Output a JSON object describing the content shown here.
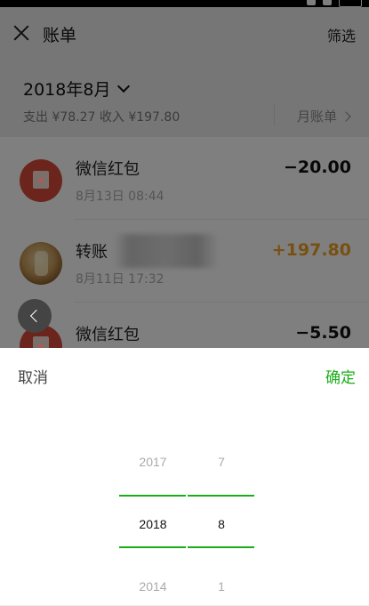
{
  "navbar": {
    "title": "账单",
    "filter_label": "筛选"
  },
  "month_header": {
    "selected_month": "2018年8月",
    "summary": "支出 ¥78.27 收入 ¥197.80",
    "month_bill_label": "月账单"
  },
  "transactions": [
    {
      "title": "微信红包",
      "time": "8月13日 08:44",
      "amount": "−20.00",
      "icon": "redpacket-icon"
    },
    {
      "title": "转账",
      "time": "8月11日 17:32",
      "amount": "+197.80",
      "icon": "contact-avatar"
    },
    {
      "title": "微信红包",
      "time": "",
      "amount": "−5.50",
      "icon": "redpacket-icon"
    }
  ],
  "picker": {
    "cancel_label": "取消",
    "confirm_label": "确定",
    "year": {
      "prev": "2017",
      "current": "2018",
      "next": "2014"
    },
    "month": {
      "prev": "7",
      "current": "8",
      "next": "1"
    }
  },
  "colors": {
    "accent_green": "#1aad19",
    "income_orange": "#f0a024",
    "redpacket_red": "#d94b3a"
  }
}
